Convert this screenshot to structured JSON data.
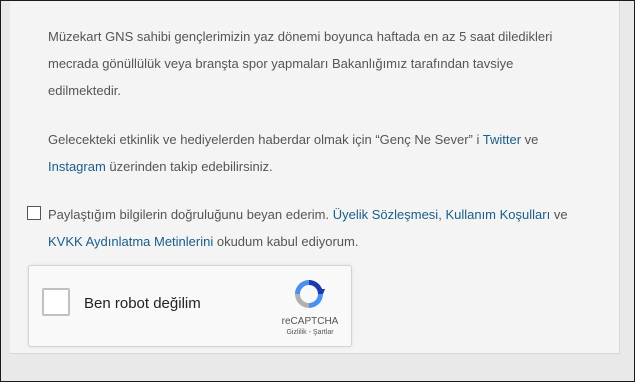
{
  "info": {
    "paragraph1": "Müzekart GNS sahibi gençlerimizin yaz dönemi boyunca haftada en az 5 saat diledikleri mecrada gönüllülük veya branşta spor yapmaları Bakanlığımız tarafından tavsiye edilmektedir.",
    "paragraph2_pre": "Gelecekteki etkinlik ve hediyelerden haberdar olmak için “Genç Ne Sever” i ",
    "twitter_link": "Twitter",
    "paragraph2_mid": " ve ",
    "instagram_link": "Instagram",
    "paragraph2_post": " üzerinden takip edebilirsiniz."
  },
  "consent": {
    "checked": false,
    "text_pre": "Paylaştığım bilgilerin doğruluğunu beyan ederim. ",
    "membership_link": "Üyelik Sözleşmesi",
    "comma": ", ",
    "terms_link": "Kullanım Koşulları",
    "and": " ve ",
    "kvkk_link": "KVKK Aydınlatma Metinlerini",
    "text_post": " okudum kabul ediyorum."
  },
  "recaptcha": {
    "label": "Ben robot değilim",
    "brand": "reCAPTCHA",
    "privacy_link": "Gizlilik",
    "separator": " - ",
    "terms_link": "Şartlar",
    "icon": "recaptcha-logo-icon"
  },
  "colors": {
    "link": "#1a5d8a",
    "text": "#555555",
    "panel": "#f4f4f4"
  }
}
